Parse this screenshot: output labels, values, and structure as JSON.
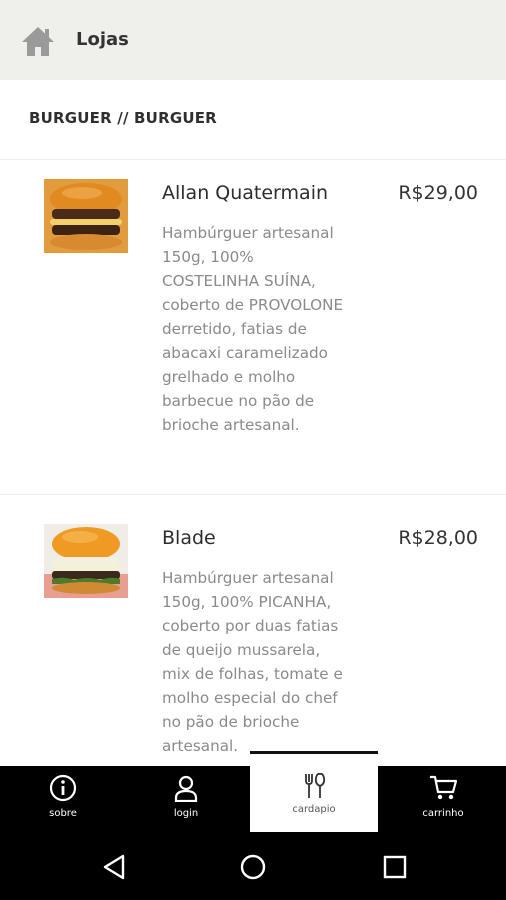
{
  "header": {
    "title": "Lojas",
    "icon": "home-icon"
  },
  "breadcrumb": "BURGUER // BURGUER",
  "items": [
    {
      "name": "Allan Quatermain",
      "price": "R$29,00",
      "description": "Hambúrguer artesanal 150g, 100% COSTELINHA SUÍNA, coberto de PROVOLONE derretido, fatias de abacaxi caramelizado grelhado e molho barbecue no pão de brioche artesanal."
    },
    {
      "name": "Blade",
      "price": "R$28,00",
      "description": "Hambúrguer artesanal 150g, 100% PICANHA, coberto por duas fatias de queijo mussarela, mix de folhas, tomate e molho especial do chef no pão de brioche artesanal."
    }
  ],
  "nav": [
    {
      "label": "sobre",
      "icon": "info-icon"
    },
    {
      "label": "login",
      "icon": "user-icon"
    },
    {
      "label": "cardapio",
      "icon": "cutlery-icon",
      "active": true
    },
    {
      "label": "carrinho",
      "icon": "cart-icon"
    }
  ],
  "system_nav": [
    "back-icon",
    "home-circle-icon",
    "recents-icon"
  ],
  "colors": {
    "header_bg": "#efefeb",
    "nav_bg": "#000000",
    "desc_text": "#8a8a8a"
  }
}
